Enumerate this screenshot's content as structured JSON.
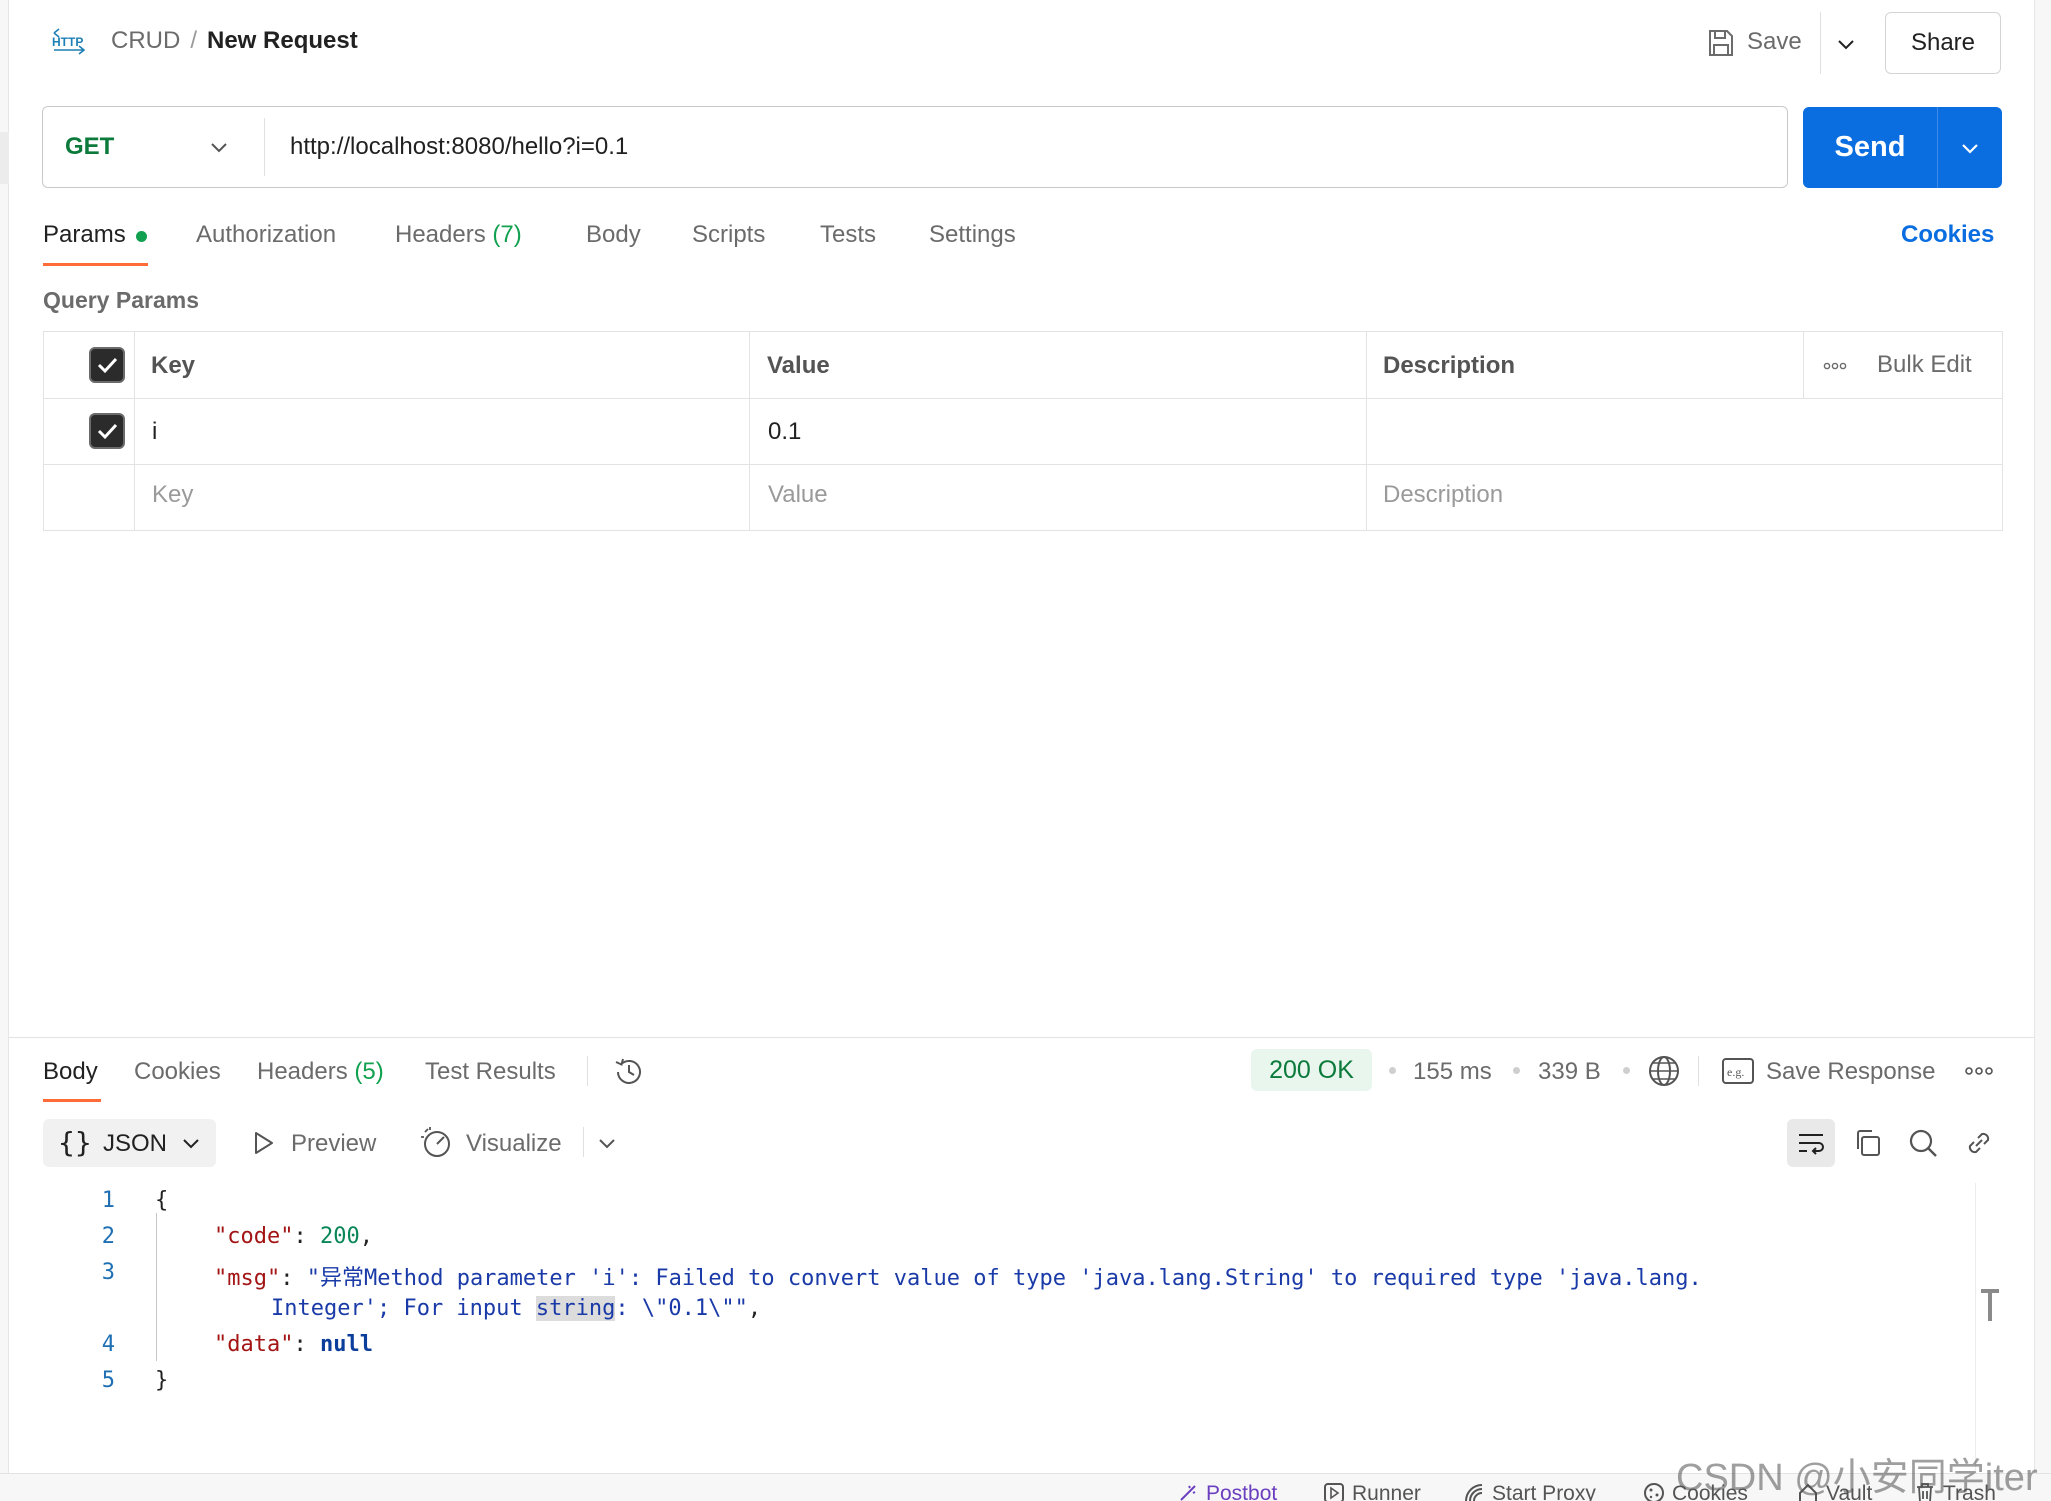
{
  "header": {
    "breadcrumb_collection": "CRUD",
    "breadcrumb_separator": "/",
    "breadcrumb_request": "New Request",
    "save_label": "Save",
    "share_label": "Share"
  },
  "request": {
    "method": "GET",
    "url": "http://localhost:8080/hello?i=0.1",
    "send_label": "Send"
  },
  "request_tabs": {
    "params": "Params",
    "authorization": "Authorization",
    "headers": "Headers",
    "headers_count": "(7)",
    "body": "Body",
    "scripts": "Scripts",
    "tests": "Tests",
    "settings": "Settings",
    "cookies": "Cookies"
  },
  "query_params": {
    "title": "Query Params",
    "columns": {
      "key": "Key",
      "value": "Value",
      "description": "Description"
    },
    "bulk_edit": "Bulk Edit",
    "rows": [
      {
        "checked": true,
        "key": "i",
        "value": "0.1",
        "description": ""
      }
    ],
    "placeholders": {
      "key": "Key",
      "value": "Value",
      "description": "Description"
    }
  },
  "response": {
    "tabs": {
      "body": "Body",
      "cookies": "Cookies",
      "headers": "Headers",
      "headers_count": "(5)",
      "test_results": "Test Results"
    },
    "status": "200 OK",
    "time": "155 ms",
    "size": "339 B",
    "save_response": "Save Response",
    "format": "JSON",
    "preview": "Preview",
    "visualize": "Visualize",
    "lines": [
      "1",
      "2",
      "3",
      "4",
      "5"
    ],
    "code": {
      "open_brace": "{",
      "code_key": "\"code\"",
      "code_value": "200",
      "msg_key": "\"msg\"",
      "msg_value_1": "\"异常Method parameter 'i': Failed to convert value of type 'java.lang.String' to required type 'java.lang.",
      "msg_value_2a": "Integer'; For input ",
      "msg_value_2b": "string",
      "msg_value_2c": ": \\\"0.1\\\"\"",
      "data_key": "\"data\"",
      "data_value": "null",
      "close_brace": "}"
    }
  },
  "footer": {
    "postbot": "Postbot",
    "runner": "Runner",
    "start_proxy": "Start Proxy",
    "cookies": "Cookies",
    "vault": "Vault",
    "trash": "Trash"
  },
  "watermark": "CSDN @小安同学iter",
  "colors": {
    "accent_orange": "#ff6c37",
    "send_blue": "#0a6de0",
    "method_green": "#0b7a3b",
    "status_green_bg": "#e8f6ee"
  }
}
